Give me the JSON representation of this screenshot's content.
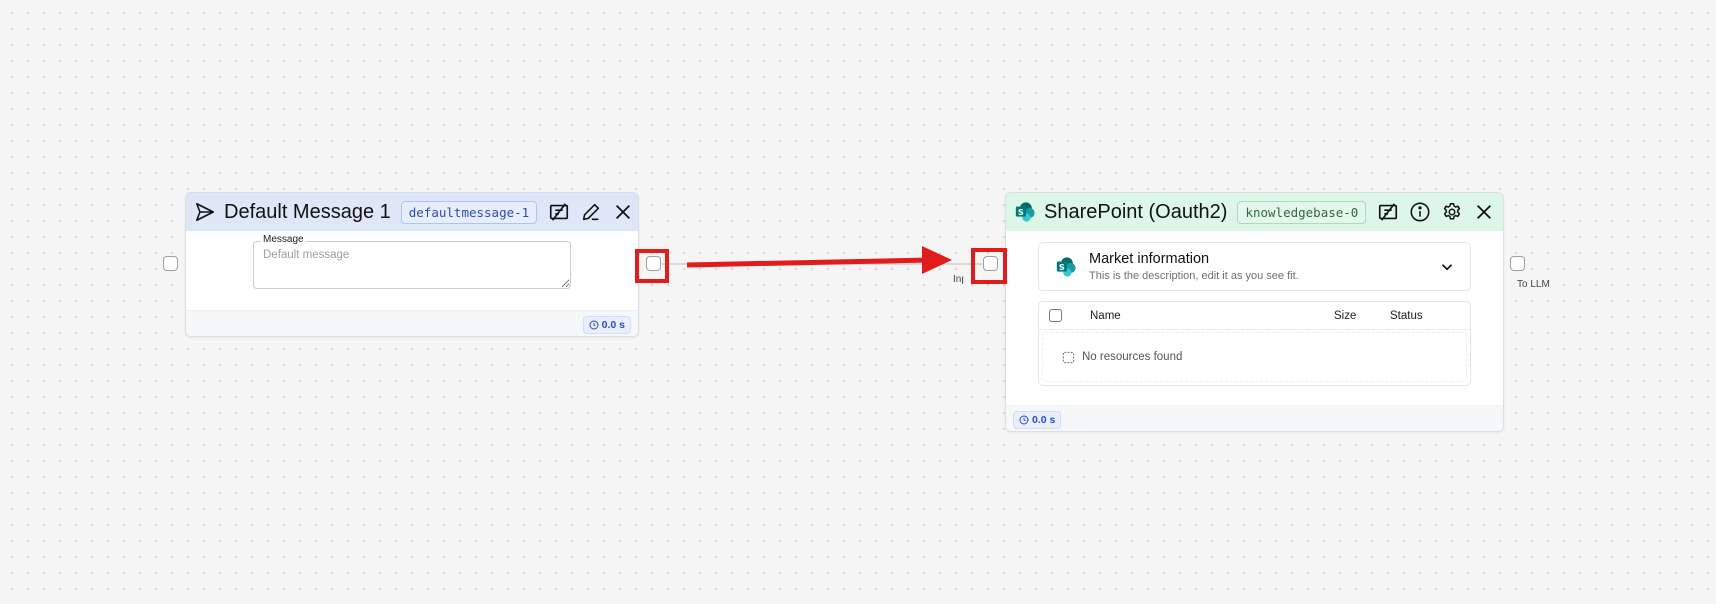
{
  "canvas": {
    "background": "#f5f5f5",
    "grid": "dots"
  },
  "edge": {
    "color": "#c8c8c8",
    "annotation_arrow_color": "#e01c1c"
  },
  "nodes": {
    "default_message": {
      "title": "Default Message 1",
      "id_badge": "defaultmessage-1",
      "header_color": "#dde7f8",
      "icons": [
        "send-icon",
        "toggle-tool-icon",
        "pencil-icon",
        "close-icon"
      ],
      "field": {
        "label": "Message",
        "placeholder": "Default message",
        "value": ""
      },
      "timer": "0.0 s"
    },
    "sharepoint": {
      "title": "SharePoint (Oauth2)",
      "id_badge": "knowledgebase-0",
      "header_color": "#ddf7e6",
      "icons": [
        "sharepoint-logo",
        "toggle-tool-icon",
        "info-icon",
        "gear-icon",
        "close-icon"
      ],
      "knowledge_base": {
        "title": "Market information",
        "description": "This is the description, edit it as you see fit."
      },
      "table": {
        "columns": [
          "Name",
          "Size",
          "Status"
        ],
        "empty_text": "No resources found"
      },
      "input_handle_label": "Input",
      "output_handle_label": "To LLM",
      "timer": "0.0 s"
    }
  }
}
